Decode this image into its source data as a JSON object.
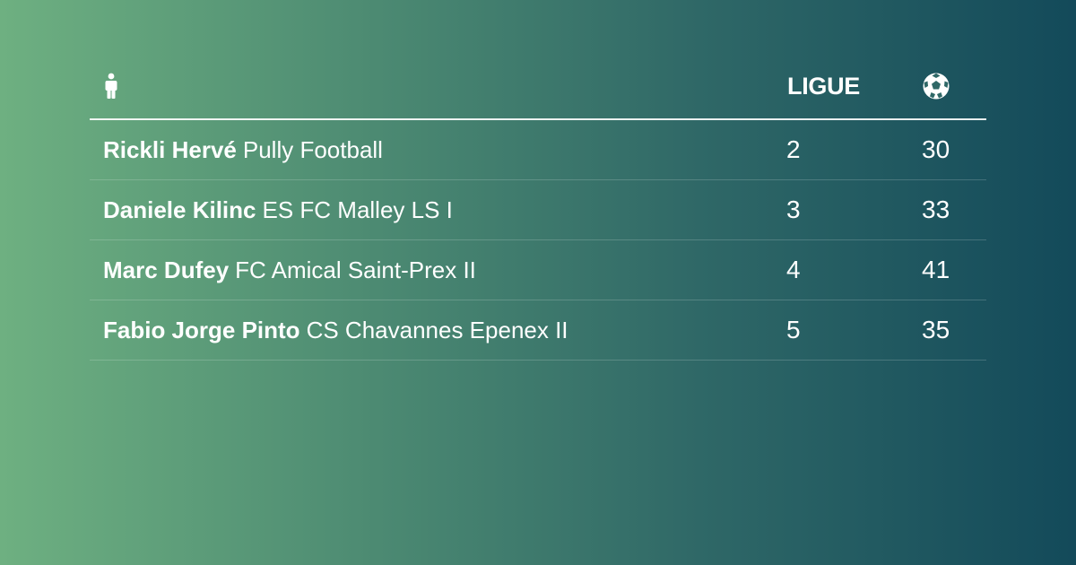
{
  "header": {
    "player_icon": "person-icon",
    "league_label": "LIGUE",
    "goals_icon": "soccer-ball-icon"
  },
  "rows": [
    {
      "player": "Rickli Hervé",
      "club": "Pully Football",
      "league": "2",
      "goals": "30"
    },
    {
      "player": "Daniele Kilinc",
      "club": "ES FC Malley LS I",
      "league": "3",
      "goals": "33"
    },
    {
      "player": "Marc Dufey",
      "club": "FC Amical Saint-Prex II",
      "league": "4",
      "goals": "41"
    },
    {
      "player": "Fabio Jorge Pinto",
      "club": "CS Chavannes Epenex II",
      "league": "5",
      "goals": "35"
    }
  ],
  "colors": {
    "gradient_start": "#6eb081",
    "gradient_end": "#134a5a",
    "text": "#ffffff"
  }
}
